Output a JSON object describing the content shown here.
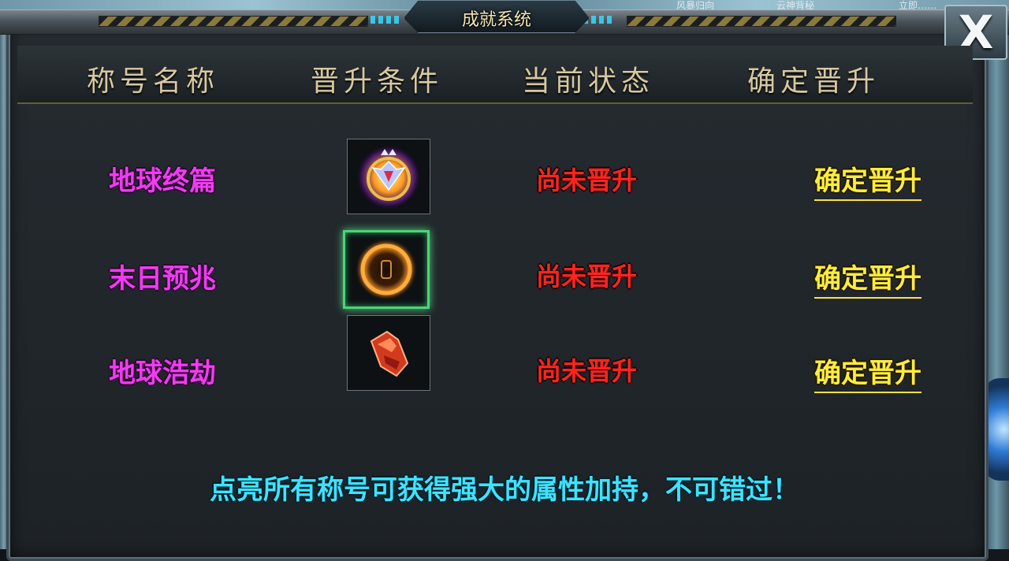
{
  "window": {
    "title": "成就系统",
    "close_label": "X"
  },
  "background_tabs": [
    "风暴归向",
    "云神背秘",
    "立即……"
  ],
  "table": {
    "headers": [
      "称号名称",
      "晋升条件",
      "当前状态",
      "确定晋升"
    ],
    "rows": [
      {
        "name": "地球终篇",
        "icon": "crowned-shield-emblem-icon",
        "status": "尚未晋升",
        "action": "确定晋升"
      },
      {
        "name": "末日预兆",
        "icon": "flaming-ring-icon",
        "status": "尚未晋升",
        "action": "确定晋升"
      },
      {
        "name": "地球浩劫",
        "icon": "red-gauntlet-icon",
        "status": "尚未晋升",
        "action": "确定晋升"
      }
    ]
  },
  "footer_note": "点亮所有称号可获得强大的属性加持，不可错过！",
  "colors": {
    "name": "#f03cf0",
    "status": "#ff2420",
    "action": "#ffec40",
    "note": "#3ee3ff",
    "header": "#d7c8a0"
  }
}
